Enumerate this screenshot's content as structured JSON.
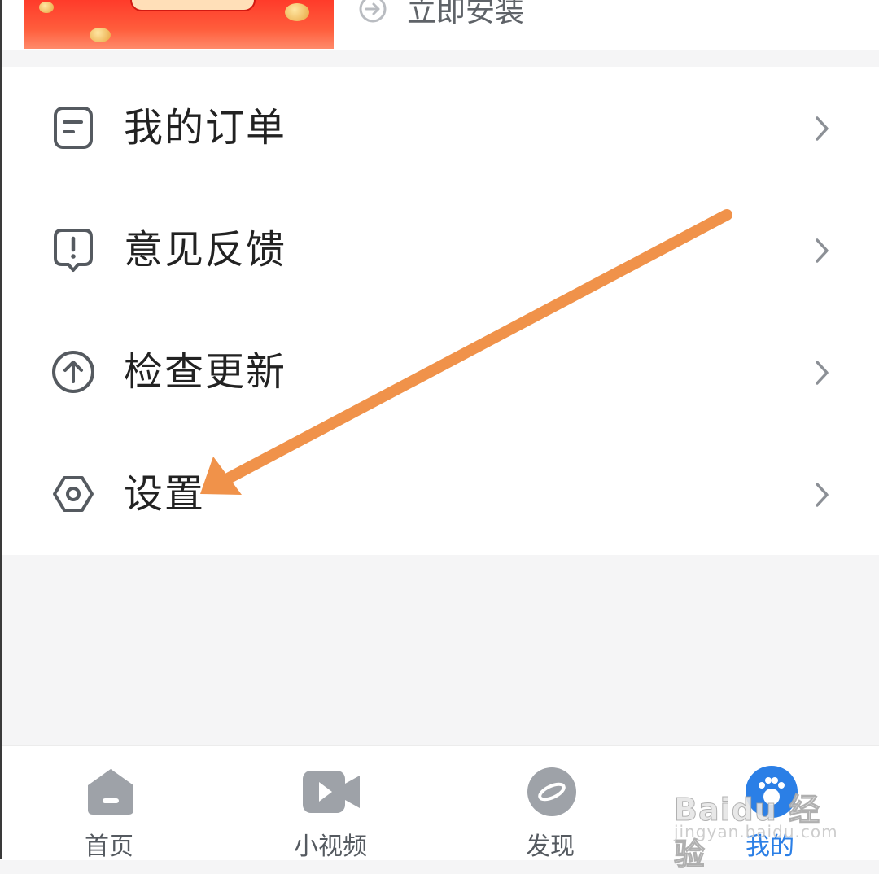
{
  "banner": {
    "install_label": "立即安装"
  },
  "menu": {
    "items": [
      {
        "label": "我的订单",
        "icon": "order-icon"
      },
      {
        "label": "意见反馈",
        "icon": "feedback-icon"
      },
      {
        "label": "检查更新",
        "icon": "update-icon"
      },
      {
        "label": "设置",
        "icon": "settings-icon"
      }
    ]
  },
  "tabbar": {
    "tabs": [
      {
        "label": "首页",
        "icon": "home-icon"
      },
      {
        "label": "小视频",
        "icon": "video-icon"
      },
      {
        "label": "发现",
        "icon": "discover-icon"
      },
      {
        "label": "我的",
        "icon": "profile-icon",
        "active": true
      }
    ]
  },
  "watermark": {
    "brand": "Baidu 经验",
    "url": "jingyan.baidu.com"
  },
  "colors": {
    "accent": "#2b7fe6",
    "annotation_arrow": "#f0924a",
    "icon_gray": "#555a60"
  }
}
